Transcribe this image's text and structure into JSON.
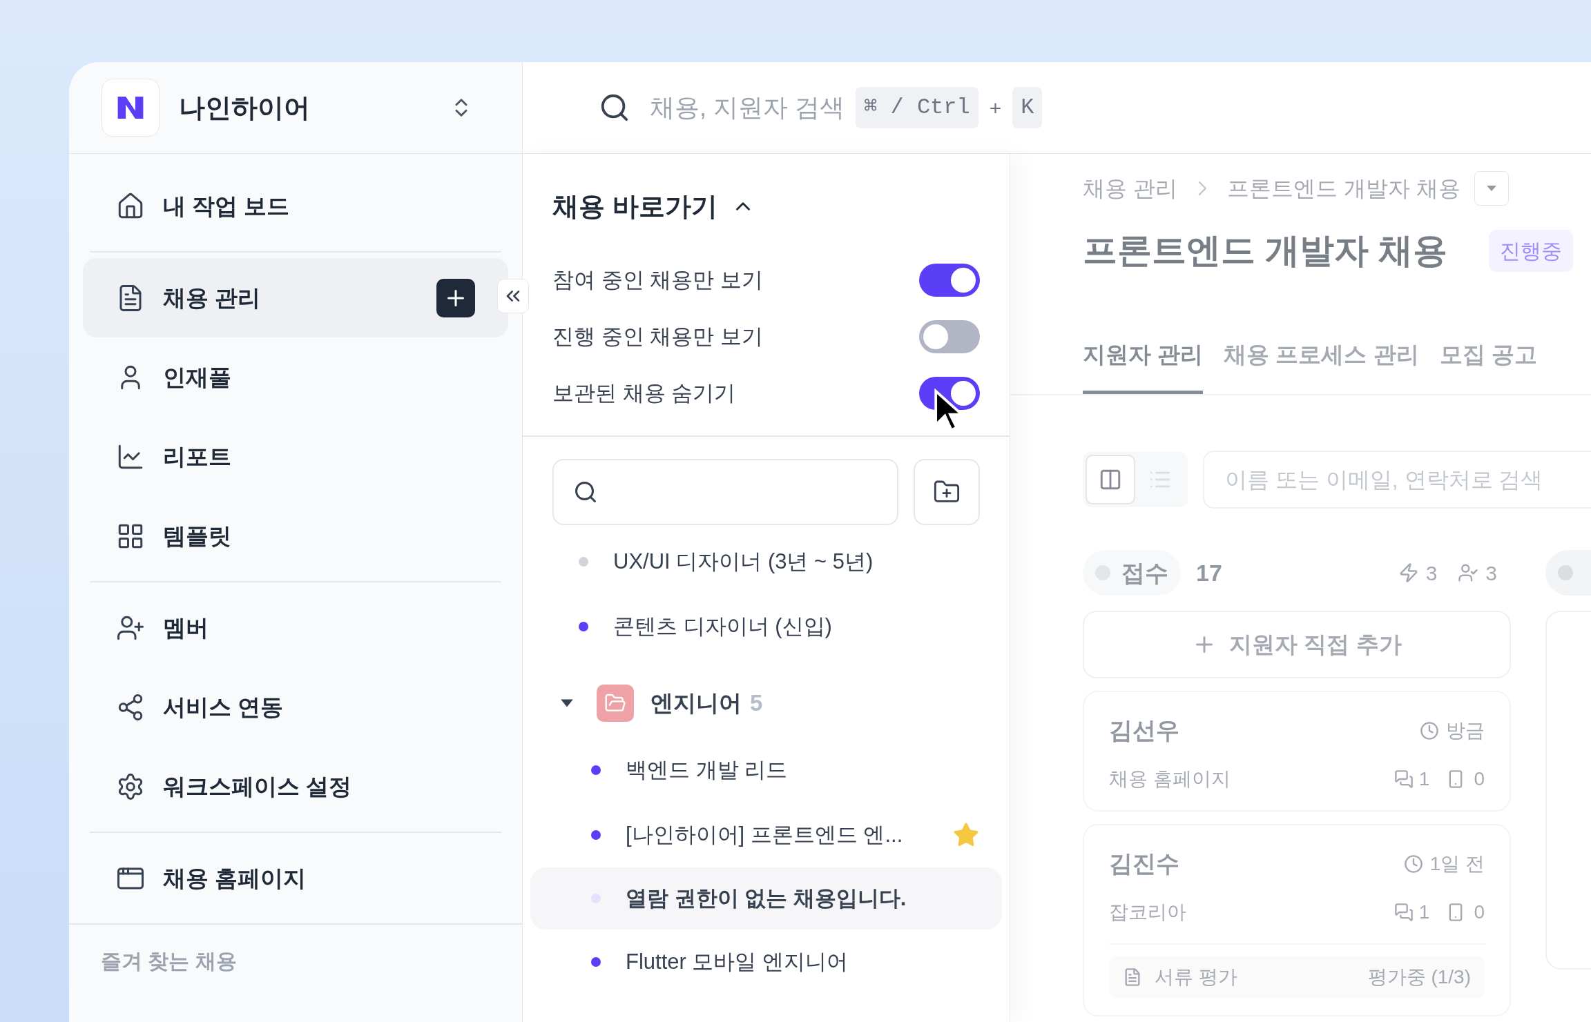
{
  "workspace": {
    "name": "나인하이어"
  },
  "search": {
    "placeholder": "채용, 지원자 검색",
    "keys": [
      "⌘ / Ctrl",
      "K"
    ],
    "joiner": "+"
  },
  "sidebar": {
    "groups": [
      [
        {
          "label": "내 작업 보드",
          "selected": false
        }
      ],
      [
        {
          "label": "채용 관리",
          "selected": true
        },
        {
          "label": "인재풀",
          "selected": false
        },
        {
          "label": "리포트",
          "selected": false
        },
        {
          "label": "템플릿",
          "selected": false
        }
      ],
      [
        {
          "label": "멤버",
          "selected": false
        },
        {
          "label": "서비스 연동",
          "selected": false
        },
        {
          "label": "워크스페이스 설정",
          "selected": false
        }
      ],
      [
        {
          "label": "채용 홈페이지",
          "selected": false
        }
      ]
    ],
    "footer": "즐겨 찾는 채용"
  },
  "shortcuts": {
    "title": "채용 바로가기",
    "expanded": true,
    "toggles": [
      {
        "label": "참여 중인 채용만 보기",
        "on": true
      },
      {
        "label": "진행 중인 채용만 보기",
        "on": false
      },
      {
        "label": "보관된 채용 숨기기",
        "on": true
      }
    ],
    "items": [
      {
        "kind": "job",
        "label": "UX/UI 디자이너 (3년 ~ 5년)",
        "color": "#d1d5db",
        "starred": false
      },
      {
        "kind": "job",
        "label": "콘텐츠 디자이너 (신입)",
        "color": "#5b3ff6",
        "starred": false
      },
      {
        "kind": "folder",
        "label": "엔지니어",
        "count": "5",
        "expanded": true,
        "children": [
          {
            "kind": "job",
            "label": "백엔드 개발 리드",
            "color": "#5b3ff6",
            "starred": false
          },
          {
            "kind": "job",
            "label": "[나인하이어] 프론트엔드 엔...",
            "color": "#5b3ff6",
            "starred": true
          },
          {
            "kind": "locked",
            "tooltip": "열람 권한이 없는 채용입니다.",
            "color": "#e4e1fb"
          },
          {
            "kind": "job",
            "label": "Flutter 모바일 엔지니어",
            "color": "#5b3ff6",
            "starred": false
          }
        ]
      }
    ]
  },
  "content": {
    "breadcrumb": [
      "채용 관리",
      "프론트엔드 개발자 채용"
    ],
    "title": "프론트엔드 개발자 채용",
    "status": "진행중",
    "tabs": [
      {
        "label": "지원자 관리",
        "selected": true
      },
      {
        "label": "채용 프로세스 관리",
        "selected": false
      },
      {
        "label": "모집 공고",
        "selected": false
      }
    ],
    "views": [
      {
        "selected": true
      },
      {
        "selected": false
      }
    ],
    "search": {
      "placeholder": "이름 또는 이메일, 연락처로 검색"
    },
    "column": {
      "name": "접수",
      "count": "17",
      "stats": [
        "3",
        "3"
      ],
      "add_label": "지원자 직접 추가",
      "cards": [
        {
          "name": "김선우",
          "time": "방금",
          "source": "채용 홈페이지",
          "comments": "1",
          "files": "0"
        },
        {
          "name": "김진수",
          "time": "1일 전",
          "source": "잡코리아",
          "comments": "1",
          "files": "0",
          "stage": {
            "label": "서류 평가",
            "status": "평가중 (1/3)"
          }
        }
      ]
    }
  }
}
